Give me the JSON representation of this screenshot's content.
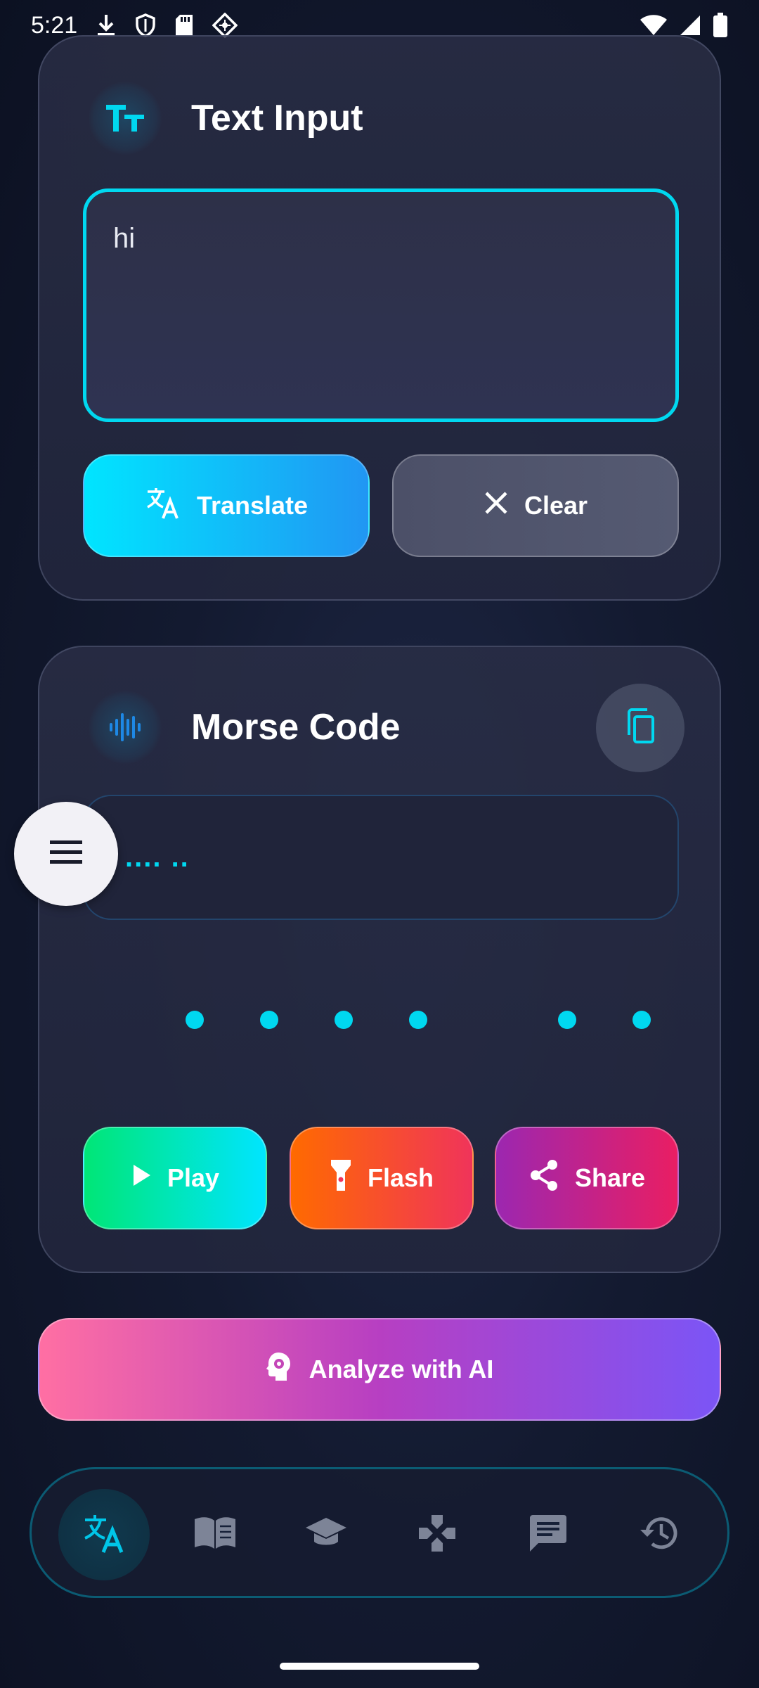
{
  "status_bar": {
    "time": "5:21",
    "left_icons": [
      "download-icon",
      "shield-icon",
      "sd-card-icon",
      "vpn-icon"
    ],
    "right_icons": [
      "wifi-icon",
      "signal-icon",
      "battery-icon"
    ]
  },
  "text_input_card": {
    "title": "Text Input",
    "icon": "text-format-icon",
    "input_value": "hi",
    "translate_label": "Translate",
    "clear_label": "Clear"
  },
  "morse_card": {
    "title": "Morse Code",
    "icon": "sound-wave-icon",
    "copy_icon": "copy-icon",
    "morse_output": ".... ..",
    "signal_pattern": [
      "dot",
      "dot",
      "dot",
      "dot",
      "gap",
      "dot",
      "dot"
    ],
    "play_label": "Play",
    "flash_label": "Flash",
    "share_label": "Share"
  },
  "analyze_button": {
    "label": "Analyze with AI",
    "icon": "ai-brain-icon"
  },
  "fab": {
    "icon": "menu-icon"
  },
  "bottom_nav": {
    "items": [
      {
        "icon": "translate-icon",
        "active": true
      },
      {
        "icon": "book-icon",
        "active": false
      },
      {
        "icon": "graduation-cap-icon",
        "active": false
      },
      {
        "icon": "gamepad-icon",
        "active": false
      },
      {
        "icon": "chat-icon",
        "active": false
      },
      {
        "icon": "history-icon",
        "active": false
      }
    ]
  },
  "colors": {
    "accent_cyan": "#00d8f0",
    "background": "#131a30",
    "translate_gradient": [
      "#00e5ff",
      "#2196f3"
    ],
    "play_gradient": [
      "#00e676",
      "#00e5ff"
    ],
    "flash_gradient": [
      "#ff6a00",
      "#f0345a"
    ],
    "share_gradient": [
      "#9c27b0",
      "#e91e63"
    ],
    "analyze_gradient": [
      "#ff6fa3",
      "#7b55f6"
    ]
  }
}
